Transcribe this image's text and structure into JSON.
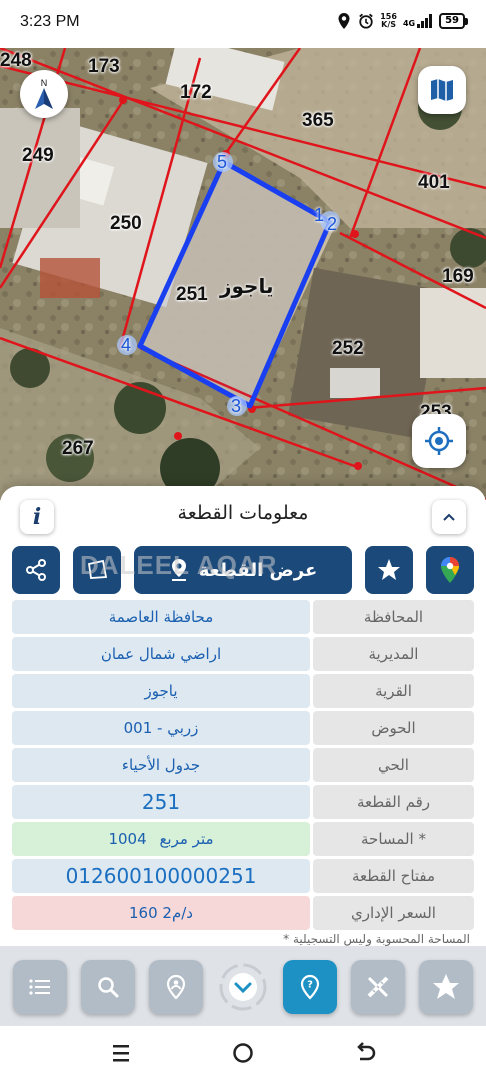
{
  "status_bar": {
    "time": "3:23 PM",
    "network_speed_value": "156",
    "network_speed_unit": "K/S",
    "network_type": "4G",
    "battery": "59",
    "icons": [
      "location-icon",
      "alarm-icon",
      "signal-icon",
      "battery-icon"
    ]
  },
  "map": {
    "parcel_labels": [
      "248",
      "173",
      "172",
      "365",
      "249",
      "250",
      "401",
      "169",
      "251",
      "252",
      "253",
      "267"
    ],
    "vertex_labels": [
      "1",
      "2",
      "3",
      "4",
      "5"
    ],
    "village_label": "ياجوز",
    "buttons": [
      "north-arrow-icon",
      "map-layers-icon",
      "locate-icon"
    ],
    "accent_color": "#1a3ff0",
    "boundary_color": "#e0141b"
  },
  "sheet": {
    "title": "معلومات القطعة",
    "watermark": "DALEEL AQAR",
    "actions": {
      "view_parcel": "عرض القطعة"
    },
    "rows": [
      {
        "label": "المحافظة",
        "value": "محافظة العاصمة"
      },
      {
        "label": "المديرية",
        "value": "اراضي شمال عمان"
      },
      {
        "label": "القرية",
        "value": "ياجوز"
      },
      {
        "label": "الحوض",
        "value": "زربي - 001"
      },
      {
        "label": "الحي",
        "value": "جدول الأحياء"
      },
      {
        "label": "رقم القطعة",
        "value": "251"
      },
      {
        "label": "المساحة *",
        "value": "1004",
        "unit": "متر مربع"
      },
      {
        "label": "مفتاح القطعة",
        "value": "012600100000251"
      },
      {
        "label": "السعر الإداري",
        "value": "160 د/م2"
      }
    ],
    "note": "* المساحة المحسوبة وليس التسجيلية"
  },
  "toolbar": {
    "buttons": [
      "list-icon",
      "search-icon",
      "place-pin-icon",
      "chevron-down-icon",
      "help-pin-icon",
      "measure-icon",
      "star-icon"
    ],
    "active_color": "#1d90c4"
  },
  "nav_bar": {
    "buttons": [
      "recent-apps-icon",
      "home-icon",
      "back-icon"
    ]
  }
}
